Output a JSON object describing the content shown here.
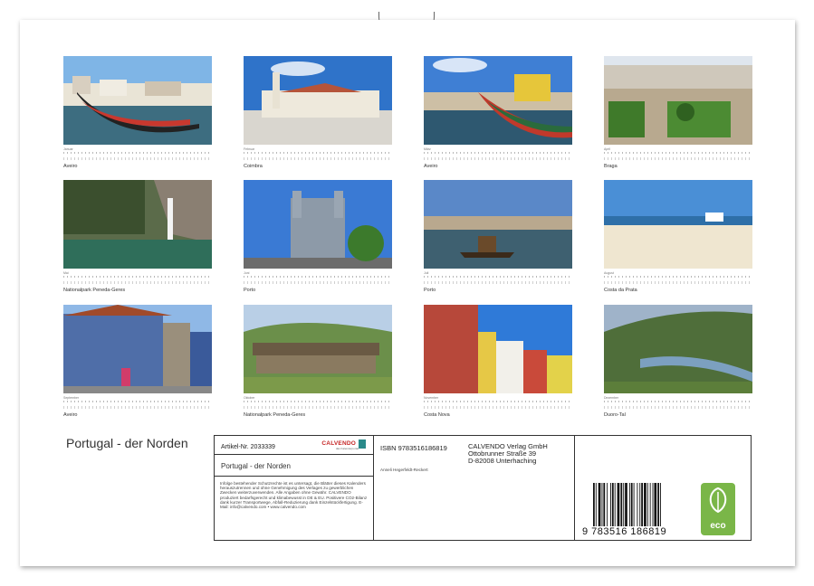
{
  "calendar": {
    "title": "Portugal - der Norden",
    "months": [
      {
        "name": "Januar",
        "caption": "Aveiro"
      },
      {
        "name": "Februar",
        "caption": "Coimbra"
      },
      {
        "name": "März",
        "caption": "Aveiro"
      },
      {
        "name": "April",
        "caption": "Braga"
      },
      {
        "name": "Mai",
        "caption": "Nationalpark Peneda-Geres"
      },
      {
        "name": "Juni",
        "caption": "Porto"
      },
      {
        "name": "Juli",
        "caption": "Porto"
      },
      {
        "name": "August",
        "caption": "Costa da Prata"
      },
      {
        "name": "September",
        "caption": "Aveiro"
      },
      {
        "name": "Oktober",
        "caption": "Nationalpark Peneda-Geres"
      },
      {
        "name": "November",
        "caption": "Costa Nova"
      },
      {
        "name": "Dezember",
        "caption": "Duoro-Tal"
      }
    ]
  },
  "info": {
    "article": "Artikel-Nr. 2033339",
    "logo": "CALVENDO",
    "logo_sub": "das Kalenderportal",
    "subtitle": "Portugal - der Norden",
    "legal": "Infolge bestehender Schutzrechte ist es untersagt, die Blätter dieses Kalenders herauszutrennen und ohne Genehmigung des Verlages zu gewerblichen Zwecken weiterzuverwenden. Alle Angaben ohne Gewähr. CALVENDO produziert bedarfsgerecht und klimabewusst in DE & EU. Positivere CO2-Bilanz dank kurzer Transportwege, Abfall-Reduzierung dank Einzelstückfertigung. E-Mail: info@calvendo.com • www.calvendo.com",
    "isbn": "ISBN 9783516186819",
    "publisher_lines": [
      "CALVENDO Verlag GmbH",
      "Ottobrunner Straße 39",
      "D-82008 Unterhaching"
    ],
    "author": "Anneli Hegerfeldt-Reckert",
    "barcode_digits": "9 783516 186819",
    "eco_label": "eco"
  }
}
